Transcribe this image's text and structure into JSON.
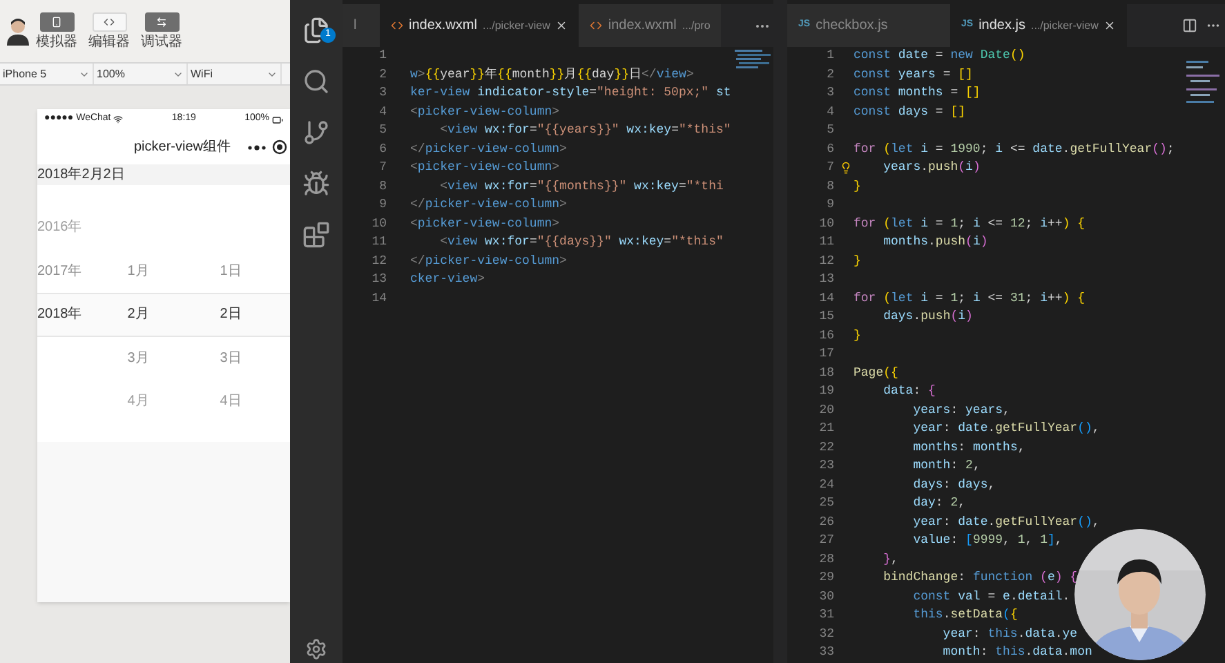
{
  "devtools": {
    "toolbar_buttons": [
      {
        "label": "模拟器",
        "on": true
      },
      {
        "label": "编辑器",
        "on": false
      },
      {
        "label": "调试器",
        "on": true
      }
    ],
    "device_bar": [
      {
        "value": "iPhone 5"
      },
      {
        "value": "100%"
      },
      {
        "value": "WiFi"
      }
    ],
    "phone": {
      "carrier": "●●●●● WeChat",
      "time": "18:19",
      "battery": "100%",
      "nav_title": "picker-view组件",
      "date_text": "2018年2月2日",
      "picker_rows": [
        {
          "year": "2016年",
          "selected": false
        },
        {
          "year": "2017年",
          "month": "1月",
          "day": "1日",
          "selected": false
        },
        {
          "year": "2018年",
          "month": "2月",
          "day": "2日",
          "selected": true
        },
        {
          "month": "3月",
          "day": "3日",
          "selected": false
        },
        {
          "month": "4月",
          "day": "4日",
          "selected": false
        }
      ]
    }
  },
  "left_editor": {
    "files_badge": "1",
    "tabs": [
      {
        "name": "l",
        "selected": false
      },
      {
        "name": "index.wxml",
        "path": ".../picker-view",
        "selected": true
      },
      {
        "name": "index.wxml",
        "path": ".../pro",
        "selected": false
      }
    ],
    "lines": [
      {
        "number": "1"
      },
      {
        "number": "2",
        "tokens": [
          {
            "text": "w",
            "kind": "tag"
          },
          {
            "text": ">",
            "kind": "punc"
          },
          {
            "text": "{{",
            "kind": "br1"
          },
          {
            "text": "year",
            "kind": "text"
          },
          {
            "text": "}}",
            "kind": "br1"
          },
          {
            "text": "年",
            "kind": "text"
          },
          {
            "text": "{{",
            "kind": "br1"
          },
          {
            "text": "month",
            "kind": "text"
          },
          {
            "text": "}}",
            "kind": "br1"
          },
          {
            "text": "月",
            "kind": "text"
          },
          {
            "text": "{{",
            "kind": "br1"
          },
          {
            "text": "day",
            "kind": "text"
          },
          {
            "text": "}}",
            "kind": "br1"
          },
          {
            "text": "日",
            "kind": "text"
          },
          {
            "text": "</",
            "kind": "punc"
          },
          {
            "text": "view",
            "kind": "tag"
          },
          {
            "text": ">",
            "kind": "punc"
          }
        ]
      },
      {
        "number": "3",
        "tokens": [
          {
            "text": "ker-view ",
            "kind": "tag"
          },
          {
            "text": "indicator-style",
            "kind": "attr"
          },
          {
            "text": "=",
            "kind": "text"
          },
          {
            "text": "\"height: 50px;\"",
            "kind": "str"
          },
          {
            "text": " st",
            "kind": "attr"
          }
        ]
      },
      {
        "number": "4",
        "tokens": [
          {
            "text": "<",
            "kind": "punc"
          },
          {
            "text": "picker-view-column",
            "kind": "tag"
          },
          {
            "text": ">",
            "kind": "punc"
          }
        ]
      },
      {
        "number": "5",
        "tokens": [
          {
            "text": "    <",
            "kind": "punc"
          },
          {
            "text": "view ",
            "kind": "tag"
          },
          {
            "text": "wx:for",
            "kind": "attr"
          },
          {
            "text": "=",
            "kind": "text"
          },
          {
            "text": "\"{{years}}\"",
            "kind": "str"
          },
          {
            "text": " wx:key",
            "kind": "attr"
          },
          {
            "text": "=",
            "kind": "text"
          },
          {
            "text": "\"*this\"",
            "kind": "str"
          }
        ]
      },
      {
        "number": "6",
        "tokens": [
          {
            "text": "</",
            "kind": "punc"
          },
          {
            "text": "picker-view-column",
            "kind": "tag"
          },
          {
            "text": ">",
            "kind": "punc"
          }
        ]
      },
      {
        "number": "7",
        "tokens": [
          {
            "text": "<",
            "kind": "punc"
          },
          {
            "text": "picker-view-column",
            "kind": "tag"
          },
          {
            "text": ">",
            "kind": "punc"
          }
        ]
      },
      {
        "number": "8",
        "tokens": [
          {
            "text": "    <",
            "kind": "punc"
          },
          {
            "text": "view ",
            "kind": "tag"
          },
          {
            "text": "wx:for",
            "kind": "attr"
          },
          {
            "text": "=",
            "kind": "text"
          },
          {
            "text": "\"{{months}}\"",
            "kind": "str"
          },
          {
            "text": " wx:key",
            "kind": "attr"
          },
          {
            "text": "=",
            "kind": "text"
          },
          {
            "text": "\"*thi",
            "kind": "str"
          }
        ]
      },
      {
        "number": "9",
        "tokens": [
          {
            "text": "</",
            "kind": "punc"
          },
          {
            "text": "picker-view-column",
            "kind": "tag"
          },
          {
            "text": ">",
            "kind": "punc"
          }
        ]
      },
      {
        "number": "10",
        "tokens": [
          {
            "text": "<",
            "kind": "punc"
          },
          {
            "text": "picker-view-column",
            "kind": "tag"
          },
          {
            "text": ">",
            "kind": "punc"
          }
        ]
      },
      {
        "number": "11",
        "tokens": [
          {
            "text": "    <",
            "kind": "punc"
          },
          {
            "text": "view ",
            "kind": "tag"
          },
          {
            "text": "wx:for",
            "kind": "attr"
          },
          {
            "text": "=",
            "kind": "text"
          },
          {
            "text": "\"{{days}}\"",
            "kind": "str"
          },
          {
            "text": " wx:key",
            "kind": "attr"
          },
          {
            "text": "=",
            "kind": "text"
          },
          {
            "text": "\"*this\"",
            "kind": "str"
          }
        ]
      },
      {
        "number": "12",
        "tokens": [
          {
            "text": "</",
            "kind": "punc"
          },
          {
            "text": "picker-view-column",
            "kind": "tag"
          },
          {
            "text": ">",
            "kind": "punc"
          }
        ]
      },
      {
        "number": "13",
        "tokens": [
          {
            "text": "cker-view",
            "kind": "tag"
          },
          {
            "text": ">",
            "kind": "punc"
          }
        ]
      },
      {
        "number": "14"
      }
    ]
  },
  "right_editor": {
    "tabs": [
      {
        "icon_label": "JS",
        "name": "checkbox.js",
        "selected": false
      },
      {
        "icon_label": "JS",
        "name": "index.js",
        "path": ".../picker-view",
        "selected": true
      }
    ],
    "lines": [
      {
        "number": "1",
        "tokens": [
          {
            "text": "const ",
            "kind": "kw"
          },
          {
            "text": "date",
            "kind": "var"
          },
          {
            "text": " = ",
            "kind": "op"
          },
          {
            "text": "new ",
            "kind": "kw"
          },
          {
            "text": "Date",
            "kind": "cls"
          },
          {
            "text": "()",
            "kind": "br1"
          }
        ]
      },
      {
        "number": "2",
        "tokens": [
          {
            "text": "const ",
            "kind": "kw"
          },
          {
            "text": "years",
            "kind": "var"
          },
          {
            "text": " = ",
            "kind": "op"
          },
          {
            "text": "[]",
            "kind": "br1"
          }
        ]
      },
      {
        "number": "3",
        "tokens": [
          {
            "text": "const ",
            "kind": "kw"
          },
          {
            "text": "months",
            "kind": "var"
          },
          {
            "text": " = ",
            "kind": "op"
          },
          {
            "text": "[]",
            "kind": "br1"
          }
        ]
      },
      {
        "number": "4",
        "tokens": [
          {
            "text": "const ",
            "kind": "kw"
          },
          {
            "text": "days",
            "kind": "var"
          },
          {
            "text": " = ",
            "kind": "op"
          },
          {
            "text": "[]",
            "kind": "br1"
          }
        ]
      },
      {
        "number": "5"
      },
      {
        "number": "6",
        "tokens": [
          {
            "text": "for ",
            "kind": "ctl"
          },
          {
            "text": "(",
            "kind": "br1"
          },
          {
            "text": "let ",
            "kind": "kw"
          },
          {
            "text": "i",
            "kind": "var"
          },
          {
            "text": " = ",
            "kind": "op"
          },
          {
            "text": "1990",
            "kind": "num"
          },
          {
            "text": "; ",
            "kind": "op"
          },
          {
            "text": "i",
            "kind": "var"
          },
          {
            "text": " <= ",
            "kind": "op"
          },
          {
            "text": "date",
            "kind": "var"
          },
          {
            "text": ".",
            "kind": "op"
          },
          {
            "text": "getFullYear",
            "kind": "fn"
          },
          {
            "text": "()",
            "kind": "br2"
          },
          {
            "text": ";",
            "kind": "op"
          }
        ]
      },
      {
        "number": "7",
        "lightbulb": true,
        "tokens": [
          {
            "text": "    years",
            "kind": "var"
          },
          {
            "text": ".",
            "kind": "op"
          },
          {
            "text": "push",
            "kind": "fn"
          },
          {
            "text": "(",
            "kind": "br2"
          },
          {
            "text": "i",
            "kind": "var"
          },
          {
            "text": ")",
            "kind": "br2"
          }
        ]
      },
      {
        "number": "8",
        "tokens": [
          {
            "text": "}",
            "kind": "br1"
          }
        ]
      },
      {
        "number": "9"
      },
      {
        "number": "10",
        "tokens": [
          {
            "text": "for ",
            "kind": "ctl"
          },
          {
            "text": "(",
            "kind": "br1"
          },
          {
            "text": "let ",
            "kind": "kw"
          },
          {
            "text": "i",
            "kind": "var"
          },
          {
            "text": " = ",
            "kind": "op"
          },
          {
            "text": "1",
            "kind": "num"
          },
          {
            "text": "; ",
            "kind": "op"
          },
          {
            "text": "i",
            "kind": "var"
          },
          {
            "text": " <= ",
            "kind": "op"
          },
          {
            "text": "12",
            "kind": "num"
          },
          {
            "text": "; ",
            "kind": "op"
          },
          {
            "text": "i",
            "kind": "var"
          },
          {
            "text": "++",
            "kind": "op"
          },
          {
            "text": ") ",
            "kind": "br1"
          },
          {
            "text": "{",
            "kind": "br1"
          }
        ]
      },
      {
        "number": "11",
        "tokens": [
          {
            "text": "    months",
            "kind": "var"
          },
          {
            "text": ".",
            "kind": "op"
          },
          {
            "text": "push",
            "kind": "fn"
          },
          {
            "text": "(",
            "kind": "br2"
          },
          {
            "text": "i",
            "kind": "var"
          },
          {
            "text": ")",
            "kind": "br2"
          }
        ]
      },
      {
        "number": "12",
        "tokens": [
          {
            "text": "}",
            "kind": "br1"
          }
        ]
      },
      {
        "number": "13"
      },
      {
        "number": "14",
        "tokens": [
          {
            "text": "for ",
            "kind": "ctl"
          },
          {
            "text": "(",
            "kind": "br1"
          },
          {
            "text": "let ",
            "kind": "kw"
          },
          {
            "text": "i",
            "kind": "var"
          },
          {
            "text": " = ",
            "kind": "op"
          },
          {
            "text": "1",
            "kind": "num"
          },
          {
            "text": "; ",
            "kind": "op"
          },
          {
            "text": "i",
            "kind": "var"
          },
          {
            "text": " <= ",
            "kind": "op"
          },
          {
            "text": "31",
            "kind": "num"
          },
          {
            "text": "; ",
            "kind": "op"
          },
          {
            "text": "i",
            "kind": "var"
          },
          {
            "text": "++",
            "kind": "op"
          },
          {
            "text": ") ",
            "kind": "br1"
          },
          {
            "text": "{",
            "kind": "br1"
          }
        ]
      },
      {
        "number": "15",
        "tokens": [
          {
            "text": "    days",
            "kind": "var"
          },
          {
            "text": ".",
            "kind": "op"
          },
          {
            "text": "push",
            "kind": "fn"
          },
          {
            "text": "(",
            "kind": "br2"
          },
          {
            "text": "i",
            "kind": "var"
          },
          {
            "text": ")",
            "kind": "br2"
          }
        ]
      },
      {
        "number": "16",
        "tokens": [
          {
            "text": "}",
            "kind": "br1"
          }
        ]
      },
      {
        "number": "17"
      },
      {
        "number": "18",
        "tokens": [
          {
            "text": "Page",
            "kind": "fn"
          },
          {
            "text": "({",
            "kind": "br1"
          }
        ]
      },
      {
        "number": "19",
        "tokens": [
          {
            "text": "    data",
            "kind": "var"
          },
          {
            "text": ": ",
            "kind": "op"
          },
          {
            "text": "{",
            "kind": "br2"
          }
        ]
      },
      {
        "number": "20",
        "tokens": [
          {
            "text": "        years",
            "kind": "var"
          },
          {
            "text": ": ",
            "kind": "op"
          },
          {
            "text": "years",
            "kind": "var"
          },
          {
            "text": ",",
            "kind": "op"
          }
        ]
      },
      {
        "number": "21",
        "tokens": [
          {
            "text": "        year",
            "kind": "var"
          },
          {
            "text": ": ",
            "kind": "op"
          },
          {
            "text": "date",
            "kind": "var"
          },
          {
            "text": ".",
            "kind": "op"
          },
          {
            "text": "getFullYear",
            "kind": "fn"
          },
          {
            "text": "()",
            "kind": "br3"
          },
          {
            "text": ",",
            "kind": "op"
          }
        ]
      },
      {
        "number": "22",
        "tokens": [
          {
            "text": "        months",
            "kind": "var"
          },
          {
            "text": ": ",
            "kind": "op"
          },
          {
            "text": "months",
            "kind": "var"
          },
          {
            "text": ",",
            "kind": "op"
          }
        ]
      },
      {
        "number": "23",
        "tokens": [
          {
            "text": "        month",
            "kind": "var"
          },
          {
            "text": ": ",
            "kind": "op"
          },
          {
            "text": "2",
            "kind": "num"
          },
          {
            "text": ",",
            "kind": "op"
          }
        ]
      },
      {
        "number": "24",
        "tokens": [
          {
            "text": "        days",
            "kind": "var"
          },
          {
            "text": ": ",
            "kind": "op"
          },
          {
            "text": "days",
            "kind": "var"
          },
          {
            "text": ",",
            "kind": "op"
          }
        ]
      },
      {
        "number": "25",
        "tokens": [
          {
            "text": "        day",
            "kind": "var"
          },
          {
            "text": ": ",
            "kind": "op"
          },
          {
            "text": "2",
            "kind": "num"
          },
          {
            "text": ",",
            "kind": "op"
          }
        ]
      },
      {
        "number": "26",
        "tokens": [
          {
            "text": "        year",
            "kind": "var"
          },
          {
            "text": ": ",
            "kind": "op"
          },
          {
            "text": "date",
            "kind": "var"
          },
          {
            "text": ".",
            "kind": "op"
          },
          {
            "text": "getFullYear",
            "kind": "fn"
          },
          {
            "text": "()",
            "kind": "br3"
          },
          {
            "text": ",",
            "kind": "op"
          }
        ]
      },
      {
        "number": "27",
        "tokens": [
          {
            "text": "        value",
            "kind": "var"
          },
          {
            "text": ": ",
            "kind": "op"
          },
          {
            "text": "[",
            "kind": "br3"
          },
          {
            "text": "9999",
            "kind": "num"
          },
          {
            "text": ", ",
            "kind": "op"
          },
          {
            "text": "1",
            "kind": "num"
          },
          {
            "text": ", ",
            "kind": "op"
          },
          {
            "text": "1",
            "kind": "num"
          },
          {
            "text": "]",
            "kind": "br3"
          },
          {
            "text": ",",
            "kind": "op"
          }
        ]
      },
      {
        "number": "28",
        "tokens": [
          {
            "text": "    }",
            "kind": "br2"
          },
          {
            "text": ",",
            "kind": "op"
          }
        ]
      },
      {
        "number": "29",
        "tokens": [
          {
            "text": "    bindChange",
            "kind": "fn"
          },
          {
            "text": ": ",
            "kind": "op"
          },
          {
            "text": "function ",
            "kind": "kw"
          },
          {
            "text": "(",
            "kind": "br2"
          },
          {
            "text": "e",
            "kind": "var"
          },
          {
            "text": ") ",
            "kind": "br2"
          },
          {
            "text": "{",
            "kind": "br2"
          }
        ]
      },
      {
        "number": "30",
        "tokens": [
          {
            "text": "        const ",
            "kind": "kw"
          },
          {
            "text": "val",
            "kind": "var"
          },
          {
            "text": " = ",
            "kind": "op"
          },
          {
            "text": "e",
            "kind": "var"
          },
          {
            "text": ".",
            "kind": "op"
          },
          {
            "text": "detail",
            "kind": "var"
          },
          {
            "text": ".",
            "kind": "op"
          }
        ]
      },
      {
        "number": "31",
        "tokens": [
          {
            "text": "        this",
            "kind": "kw"
          },
          {
            "text": ".",
            "kind": "op"
          },
          {
            "text": "setData",
            "kind": "fn"
          },
          {
            "text": "(",
            "kind": "br3"
          },
          {
            "text": "{",
            "kind": "br1"
          }
        ]
      },
      {
        "number": "32",
        "tokens": [
          {
            "text": "            year",
            "kind": "var"
          },
          {
            "text": ": ",
            "kind": "op"
          },
          {
            "text": "this",
            "kind": "kw"
          },
          {
            "text": ".",
            "kind": "op"
          },
          {
            "text": "data",
            "kind": "var"
          },
          {
            "text": ".",
            "kind": "op"
          },
          {
            "text": "ye",
            "kind": "var"
          }
        ]
      },
      {
        "number": "33",
        "tokens": [
          {
            "text": "            month",
            "kind": "var"
          },
          {
            "text": ": ",
            "kind": "op"
          },
          {
            "text": "this",
            "kind": "kw"
          },
          {
            "text": ".",
            "kind": "op"
          },
          {
            "text": "data",
            "kind": "var"
          },
          {
            "text": ".",
            "kind": "op"
          },
          {
            "text": "mon",
            "kind": "var"
          }
        ]
      }
    ]
  }
}
